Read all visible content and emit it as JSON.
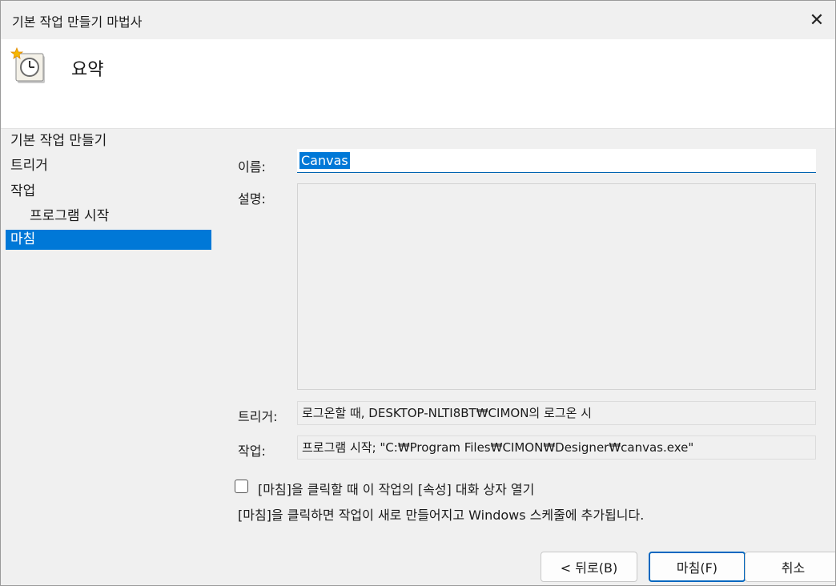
{
  "window": {
    "title": "기본 작업 만들기 마법사",
    "close_glyph": "✕"
  },
  "header": {
    "title": "요약",
    "icon": "task-scheduler-clock-icon"
  },
  "nav": {
    "items": [
      {
        "label": "기본 작업 만들기",
        "level": 0,
        "selected": false
      },
      {
        "label": "트리거",
        "level": 0,
        "selected": false
      },
      {
        "label": "작업",
        "level": 0,
        "selected": false
      },
      {
        "label": "프로그램 시작",
        "level": 1,
        "selected": false
      },
      {
        "label": "마침",
        "level": 0,
        "selected": true
      }
    ]
  },
  "form": {
    "name_label": "이름:",
    "name_value": "Canvas",
    "desc_label": "설명:",
    "desc_value": "",
    "trigger_label": "트리거:",
    "trigger_value": "로그온할 때, DESKTOP-NLTI8BT₩CIMON의 로그온 시",
    "action_label": "작업:",
    "action_value": "프로그램 시작; \"C:₩Program Files₩CIMON₩Designer₩canvas.exe\"",
    "open_properties_label": "[마침]을 클릭할 때 이 작업의 [속성] 대화 상자 열기",
    "open_properties_checked": false,
    "note": "[마침]을 클릭하면 작업이 새로 만들어지고 Windows 스케줄에 추가됩니다."
  },
  "buttons": {
    "back": "< 뒤로(B)",
    "finish": "마침(F)",
    "cancel": "취소"
  },
  "colors": {
    "accent": "#0078d7",
    "window_bg": "#f0f0f0",
    "header_bg": "#ffffff"
  }
}
